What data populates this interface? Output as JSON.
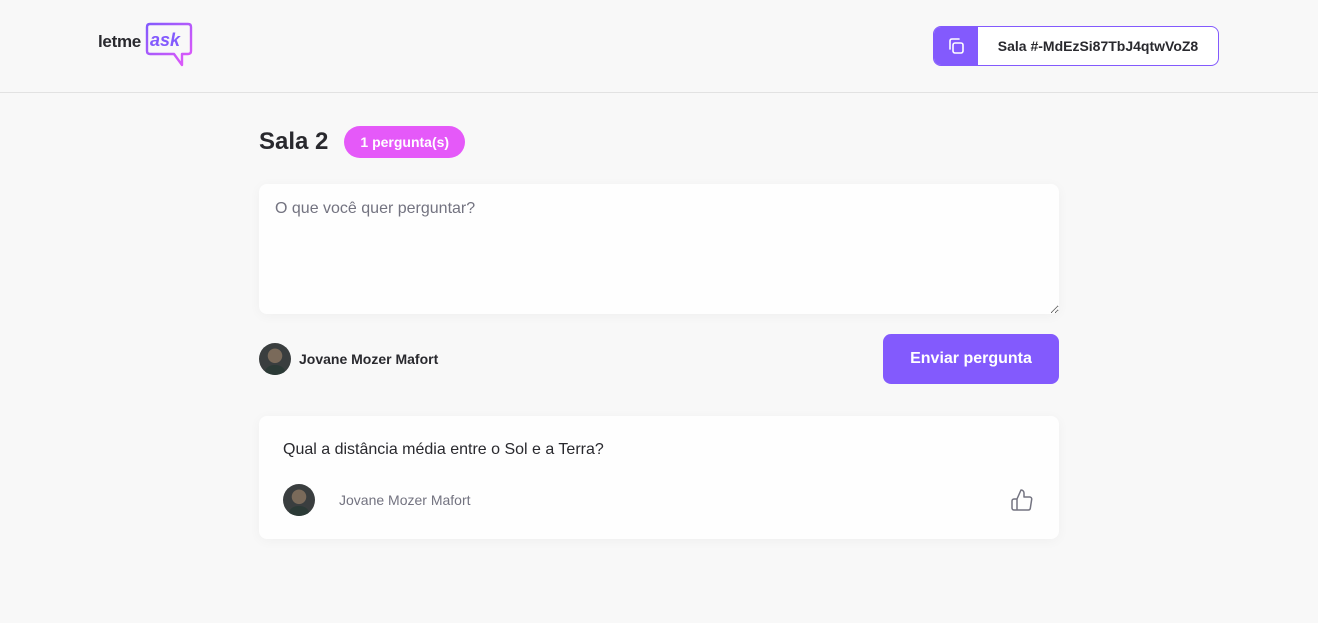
{
  "header": {
    "logo": {
      "letme": "letme",
      "ask": "ask"
    },
    "room_code": {
      "label": "Sala #-MdEzSi87TbJ4qtwVoZ8"
    }
  },
  "room": {
    "title": "Sala 2",
    "badge": "1 pergunta(s)"
  },
  "form": {
    "placeholder": "O que você quer perguntar?",
    "user_name": "Jovane Mozer Mafort",
    "send_label": "Enviar pergunta"
  },
  "questions": [
    {
      "content": "Qual a distância média entre o Sol e a Terra?",
      "author": "Jovane Mozer Mafort"
    }
  ],
  "colors": {
    "primary": "#835afd",
    "badge": "#e559f9",
    "background": "#f8f8f8",
    "text": "#29292e",
    "muted": "#737380"
  },
  "icons": {
    "copy": "copy-icon",
    "like": "thumbs-up-icon",
    "logo": "speech-bubble-logo"
  }
}
